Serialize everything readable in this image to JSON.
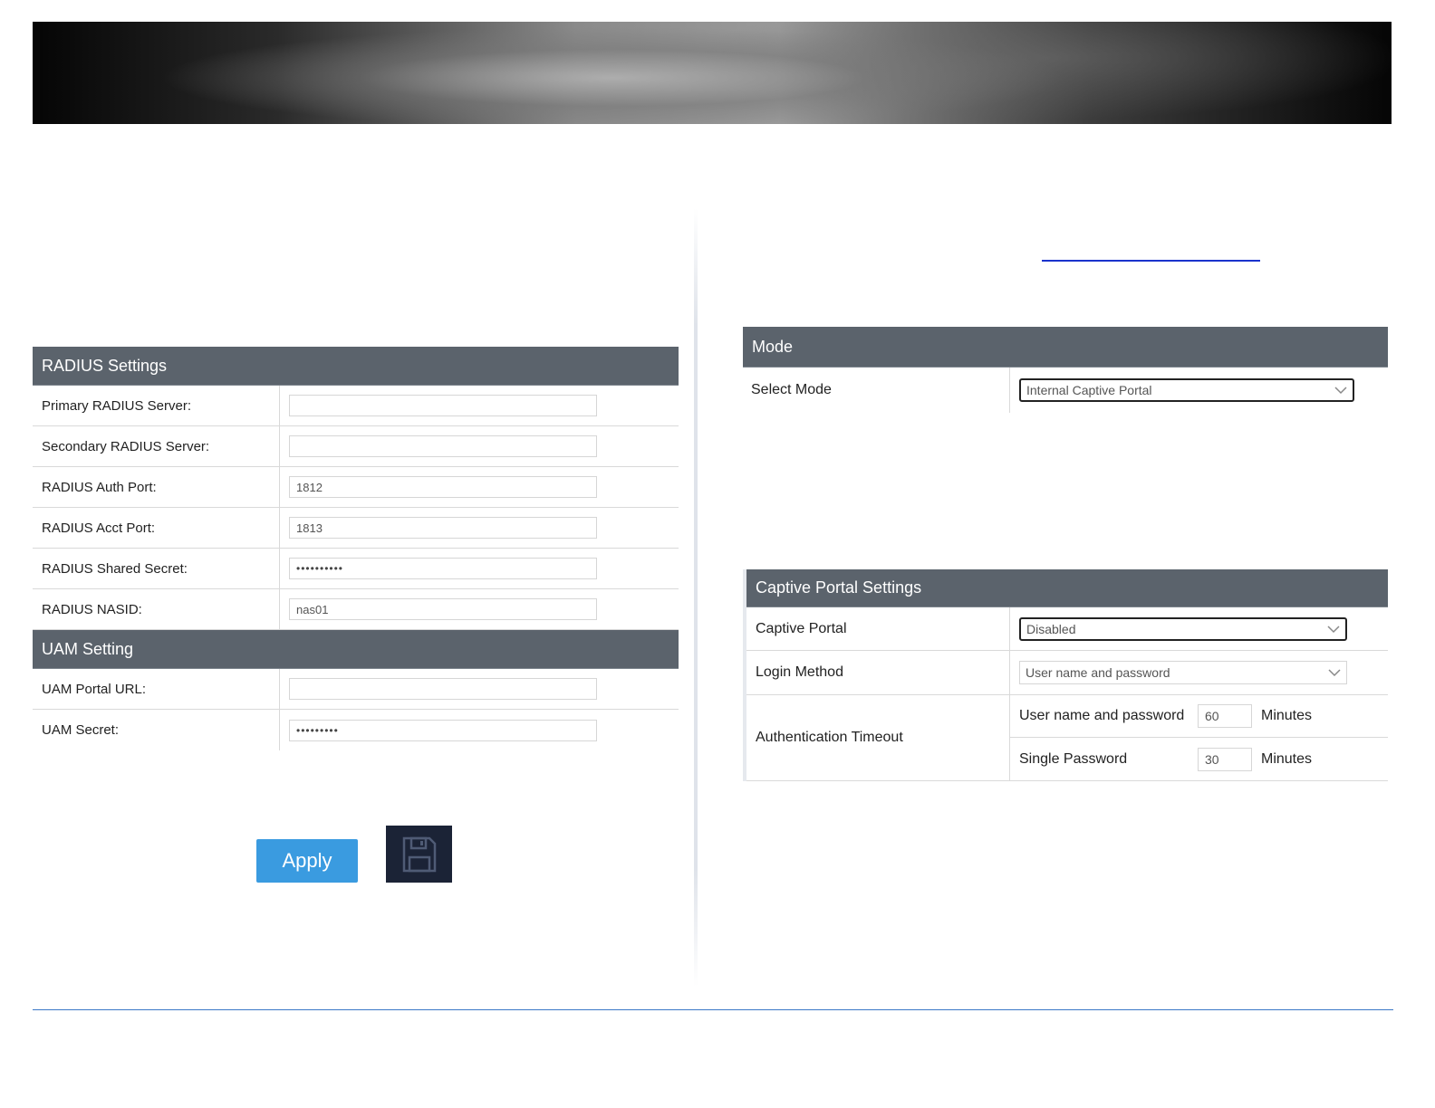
{
  "radius": {
    "title": "RADIUS Settings",
    "rows": [
      {
        "label": "Primary RADIUS Server:",
        "value": ""
      },
      {
        "label": "Secondary RADIUS Server:",
        "value": ""
      },
      {
        "label": "RADIUS Auth Port:",
        "value": "1812"
      },
      {
        "label": "RADIUS Acct Port:",
        "value": "1813"
      },
      {
        "label": "RADIUS Shared Secret:",
        "value": "••••••••••"
      },
      {
        "label": "RADIUS NASID:",
        "value": "nas01"
      }
    ]
  },
  "uam": {
    "title": "UAM Setting",
    "rows": [
      {
        "label": "UAM Portal URL:",
        "value": ""
      },
      {
        "label": "UAM Secret:",
        "value": "•••••••••"
      }
    ]
  },
  "actions": {
    "apply_label": "Apply",
    "save_icon": "floppy-disk-icon"
  },
  "mode": {
    "title": "Mode",
    "select_mode_label": "Select Mode",
    "select_mode_value": "Internal Captive Portal"
  },
  "captive": {
    "title": "Captive Portal Settings",
    "portal_label": "Captive Portal",
    "portal_value": "Disabled",
    "login_method_label": "Login Method",
    "login_method_value": "User name and password",
    "auth_timeout_label": "Authentication Timeout",
    "timeouts": [
      {
        "label": "User name and password",
        "value": "60",
        "unit": "Minutes"
      },
      {
        "label": "Single Password",
        "value": "30",
        "unit": "Minutes"
      }
    ]
  },
  "colors": {
    "header_bg": "#5b636c",
    "apply_bg": "#3a9be0",
    "save_bg": "#1b2336",
    "link": "#1a33cc"
  }
}
